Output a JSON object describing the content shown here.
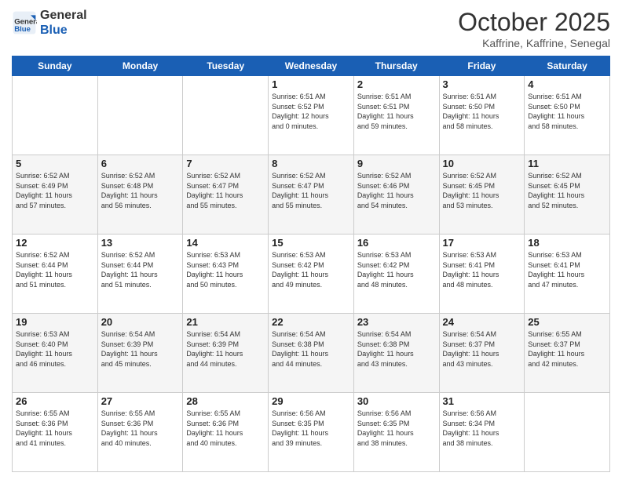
{
  "header": {
    "logo_line1": "General",
    "logo_line2": "Blue",
    "month": "October 2025",
    "location": "Kaffrine, Kaffrine, Senegal"
  },
  "weekdays": [
    "Sunday",
    "Monday",
    "Tuesday",
    "Wednesday",
    "Thursday",
    "Friday",
    "Saturday"
  ],
  "weeks": [
    [
      {
        "day": "",
        "info": ""
      },
      {
        "day": "",
        "info": ""
      },
      {
        "day": "",
        "info": ""
      },
      {
        "day": "1",
        "info": "Sunrise: 6:51 AM\nSunset: 6:52 PM\nDaylight: 12 hours\nand 0 minutes."
      },
      {
        "day": "2",
        "info": "Sunrise: 6:51 AM\nSunset: 6:51 PM\nDaylight: 11 hours\nand 59 minutes."
      },
      {
        "day": "3",
        "info": "Sunrise: 6:51 AM\nSunset: 6:50 PM\nDaylight: 11 hours\nand 58 minutes."
      },
      {
        "day": "4",
        "info": "Sunrise: 6:51 AM\nSunset: 6:50 PM\nDaylight: 11 hours\nand 58 minutes."
      }
    ],
    [
      {
        "day": "5",
        "info": "Sunrise: 6:52 AM\nSunset: 6:49 PM\nDaylight: 11 hours\nand 57 minutes."
      },
      {
        "day": "6",
        "info": "Sunrise: 6:52 AM\nSunset: 6:48 PM\nDaylight: 11 hours\nand 56 minutes."
      },
      {
        "day": "7",
        "info": "Sunrise: 6:52 AM\nSunset: 6:47 PM\nDaylight: 11 hours\nand 55 minutes."
      },
      {
        "day": "8",
        "info": "Sunrise: 6:52 AM\nSunset: 6:47 PM\nDaylight: 11 hours\nand 55 minutes."
      },
      {
        "day": "9",
        "info": "Sunrise: 6:52 AM\nSunset: 6:46 PM\nDaylight: 11 hours\nand 54 minutes."
      },
      {
        "day": "10",
        "info": "Sunrise: 6:52 AM\nSunset: 6:45 PM\nDaylight: 11 hours\nand 53 minutes."
      },
      {
        "day": "11",
        "info": "Sunrise: 6:52 AM\nSunset: 6:45 PM\nDaylight: 11 hours\nand 52 minutes."
      }
    ],
    [
      {
        "day": "12",
        "info": "Sunrise: 6:52 AM\nSunset: 6:44 PM\nDaylight: 11 hours\nand 51 minutes."
      },
      {
        "day": "13",
        "info": "Sunrise: 6:52 AM\nSunset: 6:44 PM\nDaylight: 11 hours\nand 51 minutes."
      },
      {
        "day": "14",
        "info": "Sunrise: 6:53 AM\nSunset: 6:43 PM\nDaylight: 11 hours\nand 50 minutes."
      },
      {
        "day": "15",
        "info": "Sunrise: 6:53 AM\nSunset: 6:42 PM\nDaylight: 11 hours\nand 49 minutes."
      },
      {
        "day": "16",
        "info": "Sunrise: 6:53 AM\nSunset: 6:42 PM\nDaylight: 11 hours\nand 48 minutes."
      },
      {
        "day": "17",
        "info": "Sunrise: 6:53 AM\nSunset: 6:41 PM\nDaylight: 11 hours\nand 48 minutes."
      },
      {
        "day": "18",
        "info": "Sunrise: 6:53 AM\nSunset: 6:41 PM\nDaylight: 11 hours\nand 47 minutes."
      }
    ],
    [
      {
        "day": "19",
        "info": "Sunrise: 6:53 AM\nSunset: 6:40 PM\nDaylight: 11 hours\nand 46 minutes."
      },
      {
        "day": "20",
        "info": "Sunrise: 6:54 AM\nSunset: 6:39 PM\nDaylight: 11 hours\nand 45 minutes."
      },
      {
        "day": "21",
        "info": "Sunrise: 6:54 AM\nSunset: 6:39 PM\nDaylight: 11 hours\nand 44 minutes."
      },
      {
        "day": "22",
        "info": "Sunrise: 6:54 AM\nSunset: 6:38 PM\nDaylight: 11 hours\nand 44 minutes."
      },
      {
        "day": "23",
        "info": "Sunrise: 6:54 AM\nSunset: 6:38 PM\nDaylight: 11 hours\nand 43 minutes."
      },
      {
        "day": "24",
        "info": "Sunrise: 6:54 AM\nSunset: 6:37 PM\nDaylight: 11 hours\nand 43 minutes."
      },
      {
        "day": "25",
        "info": "Sunrise: 6:55 AM\nSunset: 6:37 PM\nDaylight: 11 hours\nand 42 minutes."
      }
    ],
    [
      {
        "day": "26",
        "info": "Sunrise: 6:55 AM\nSunset: 6:36 PM\nDaylight: 11 hours\nand 41 minutes."
      },
      {
        "day": "27",
        "info": "Sunrise: 6:55 AM\nSunset: 6:36 PM\nDaylight: 11 hours\nand 40 minutes."
      },
      {
        "day": "28",
        "info": "Sunrise: 6:55 AM\nSunset: 6:36 PM\nDaylight: 11 hours\nand 40 minutes."
      },
      {
        "day": "29",
        "info": "Sunrise: 6:56 AM\nSunset: 6:35 PM\nDaylight: 11 hours\nand 39 minutes."
      },
      {
        "day": "30",
        "info": "Sunrise: 6:56 AM\nSunset: 6:35 PM\nDaylight: 11 hours\nand 38 minutes."
      },
      {
        "day": "31",
        "info": "Sunrise: 6:56 AM\nSunset: 6:34 PM\nDaylight: 11 hours\nand 38 minutes."
      },
      {
        "day": "",
        "info": ""
      }
    ]
  ]
}
